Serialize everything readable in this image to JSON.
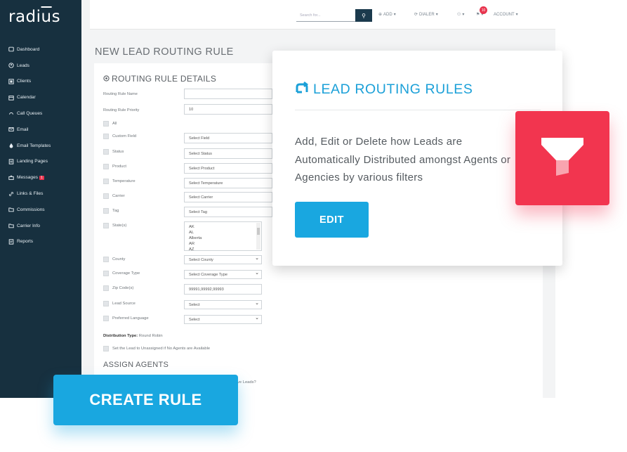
{
  "app": {
    "logo": "radius"
  },
  "sidebar": {
    "items": [
      {
        "label": "Dashboard",
        "icon": "dashboard-icon"
      },
      {
        "label": "Leads",
        "icon": "leads-icon"
      },
      {
        "label": "Clients",
        "icon": "clients-icon"
      },
      {
        "label": "Calendar",
        "icon": "calendar-icon"
      },
      {
        "label": "Call Queues",
        "icon": "call-queues-icon"
      },
      {
        "label": "Email",
        "icon": "email-icon"
      },
      {
        "label": "Email Templates",
        "icon": "drop-icon"
      },
      {
        "label": "Landing Pages",
        "icon": "landing-pages-icon"
      },
      {
        "label": "Messages",
        "icon": "messages-icon",
        "badge": "1"
      },
      {
        "label": "Links & Files",
        "icon": "link-icon"
      },
      {
        "label": "Commissions",
        "icon": "folder-icon"
      },
      {
        "label": "Carrier Info",
        "icon": "folder-icon"
      },
      {
        "label": "Reports",
        "icon": "reports-icon"
      }
    ]
  },
  "topbar": {
    "search_placeholder": "Search for...",
    "add_label": "ADD",
    "dialer_label": "DIALER",
    "notification_count": "10",
    "account_label": "ACCOUNT"
  },
  "page": {
    "heading": "NEW LEAD ROUTING RULE"
  },
  "form": {
    "section_title": "ROUTING RULE DETAILS",
    "rule_name_label": "Routing Rule Name",
    "rule_name_value": "",
    "priority_label": "Routing Rule Priority",
    "priority_value": "10",
    "all_label": "All",
    "custom_field_label": "Custom Field",
    "custom_field_select": "Select Field",
    "status_label": "Status",
    "status_select": "Select Status",
    "product_label": "Product",
    "product_select": "Select Product",
    "temperature_label": "Temperature",
    "temperature_select": "Select Temperature",
    "carrier_label": "Carrier",
    "carrier_select": "Select Carrier",
    "tag_label": "Tag",
    "tag_select": "Select Tag",
    "states_label": "State(s)",
    "states_options": [
      "AK",
      "AL",
      "Alberta",
      "AR",
      "AZ"
    ],
    "county_label": "County",
    "county_select": "Select County",
    "coverage_label": "Coverage Type",
    "coverage_select": "Select Coverage Type",
    "zip_label": "Zip Code(s)",
    "zip_value": "99991,99992,99993",
    "lead_source_label": "Lead Source",
    "lead_source_select": "Select",
    "language_label": "Preferred Language",
    "language_select": "Select",
    "distribution_label": "Distribution Type:",
    "distribution_value": "Round Robin",
    "unassigned_label": "Set the Lead to Unassigned if No Agents are Available",
    "assign_title": "ASSIGN AGENTS",
    "partial_text": "ve Leads?"
  },
  "info_card": {
    "title": "LEAD ROUTING RULES",
    "description": "Add, Edit or Delete how Leads are Automatically Distributed amongst Agents or Agencies by various filters",
    "edit_label": "EDIT"
  },
  "filter_tile": {
    "icon": "filter-icon",
    "color": "#f2354f"
  },
  "create_rule": {
    "label": "CREATE RULE"
  },
  "colors": {
    "sidebar": "#17303f",
    "accent": "#19a7e0",
    "filter": "#f2354f"
  }
}
